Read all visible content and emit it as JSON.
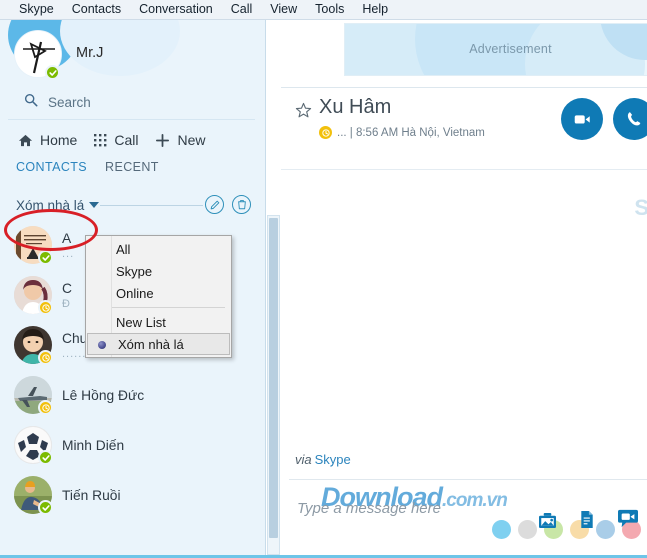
{
  "menubar": {
    "items": [
      {
        "label": "Skype"
      },
      {
        "label": "Contacts"
      },
      {
        "label": "Conversation"
      },
      {
        "label": "Call"
      },
      {
        "label": "View"
      },
      {
        "label": "Tools"
      },
      {
        "label": "Help"
      }
    ]
  },
  "sidebar": {
    "profile": {
      "name": "Mr.J",
      "status": "online",
      "avatar_icon": "user-avatar"
    },
    "search": {
      "placeholder": "Search",
      "icon": "search-icon"
    },
    "nav": [
      {
        "label": "Home",
        "icon": "home-icon"
      },
      {
        "label": "Call",
        "icon": "dialpad-icon"
      },
      {
        "label": "New",
        "icon": "plus-icon"
      }
    ],
    "tabs": [
      {
        "label": "CONTACTS",
        "active": true
      },
      {
        "label": "RECENT",
        "active": false
      }
    ],
    "list_header": {
      "label": "Xóm nhà lá",
      "caret_icon": "chevron-down-icon",
      "edit_icon": "pencil-icon",
      "delete_icon": "trash-icon"
    },
    "contacts": [
      {
        "name": "A",
        "sub": "...",
        "status": "online",
        "avatar": "quote-card-avatar"
      },
      {
        "name": "C",
        "sub": "Đ",
        "status": "away",
        "avatar": "woman-pink-avatar"
      },
      {
        "name": "Chu Minh Hương",
        "sub": "...........",
        "status": "away",
        "avatar": "woman-teal-avatar"
      },
      {
        "name": "Lê Hồng Đức",
        "sub": "",
        "status": "away",
        "avatar": "airplane-avatar"
      },
      {
        "name": "Minh Diến",
        "sub": "",
        "status": "online",
        "avatar": "football-avatar"
      },
      {
        "name": "Tiến Ruồi",
        "sub": "",
        "status": "online",
        "avatar": "person-outdoor-avatar"
      }
    ]
  },
  "dropdown": {
    "items": [
      {
        "label": "All",
        "selected": false,
        "separator_after": false
      },
      {
        "label": "Skype",
        "selected": false,
        "separator_after": false
      },
      {
        "label": "Online",
        "selected": false,
        "separator_after": true
      },
      {
        "label": "New List",
        "selected": false,
        "separator_after": false
      },
      {
        "label": "Xóm nhà lá",
        "selected": true,
        "separator_after": false
      }
    ]
  },
  "main": {
    "ad": {
      "label": "Advertisement"
    },
    "conversation": {
      "title": "Xu Hâm",
      "star_icon": "star-outline-icon",
      "status_line": "... | 8:56 AM Hà Nội, Vietnam",
      "video_call_icon": "video-call-icon",
      "voice_call_icon": "phone-call-icon"
    },
    "via": {
      "prefix": "via",
      "service": "Skype"
    },
    "composer": {
      "placeholder": "Type a message here",
      "icons": [
        {
          "name": "picture-icon"
        },
        {
          "name": "document-icon"
        },
        {
          "name": "video-message-icon"
        }
      ],
      "dot_colors": [
        "#7fd0f0",
        "#dcdcdc",
        "#c8e6a6",
        "#f8dca8",
        "#a9cde8",
        "#f4a9b0"
      ]
    },
    "watermark": {
      "main": "Download",
      "tail": ".com.vn"
    }
  },
  "colors": {
    "skype_blue": "#0f7ab5",
    "sidebar_bg": "#eaf4fb",
    "online_green": "#7cbb00",
    "away_yellow": "#f2c00c",
    "annotation_red": "#d81f26"
  }
}
